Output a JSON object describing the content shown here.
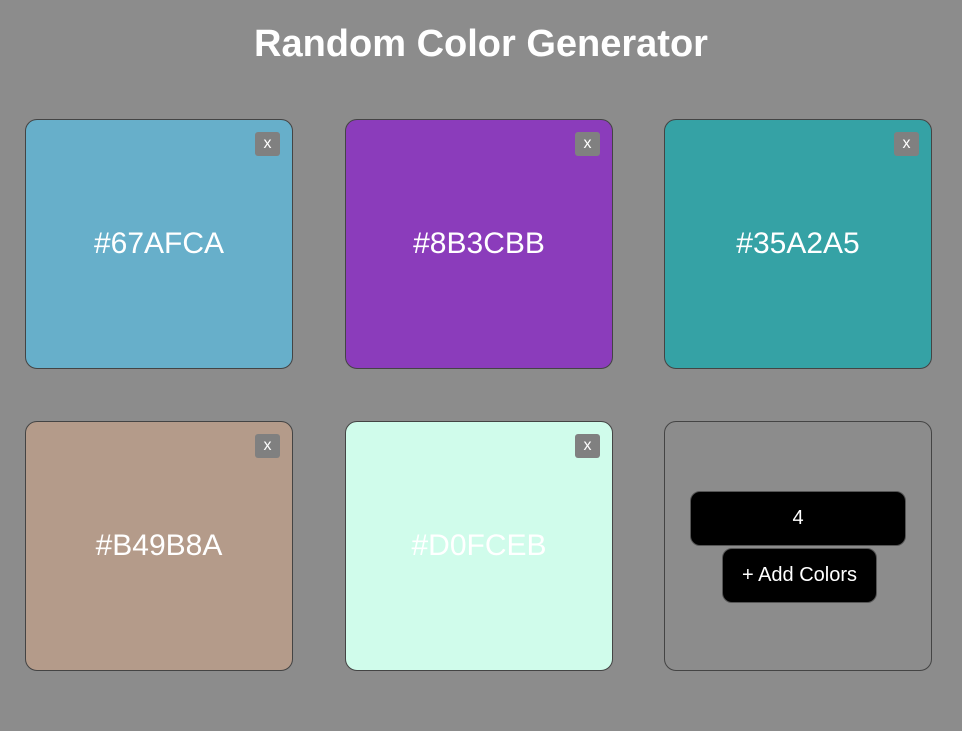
{
  "page": {
    "title": "Random Color Generator",
    "background": "#8c8c8c"
  },
  "colors": [
    {
      "hex": "#67AFCA",
      "close_label": "x"
    },
    {
      "hex": "#8B3CBB",
      "close_label": "x"
    },
    {
      "hex": "#35A2A5",
      "close_label": "x"
    },
    {
      "hex": "#B49B8A",
      "close_label": "x"
    },
    {
      "hex": "#D0FCEB",
      "close_label": "x"
    }
  ],
  "controls": {
    "count_value": "4",
    "add_button_label": "+ Add Colors"
  }
}
